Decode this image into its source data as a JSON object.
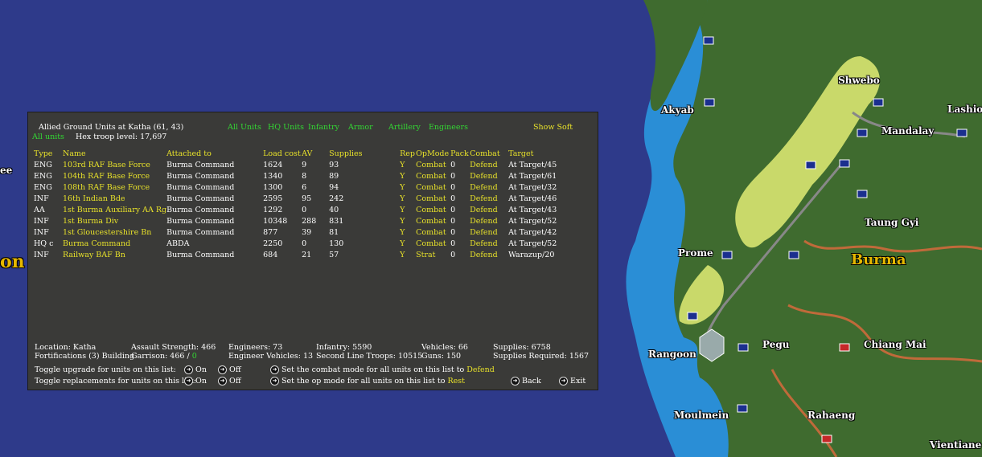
{
  "map": {
    "labels": [
      "ee",
      "on",
      "Akyab",
      "Shwebo",
      "Lashio",
      "Mandalay",
      "Taung Gyi",
      "Burma",
      "Prome",
      "Rangoon",
      "Pegu",
      "Chiang Mai",
      "Moulmein",
      "Rahaeng",
      "Vientiane"
    ],
    "land_color": "#3f6b2f",
    "sea_color": "#2e3a8a",
    "coast_color": "#2a8ed6",
    "highlight_color": "#c9d96a"
  },
  "panel": {
    "title": "Allied Ground Units at Katha  (61, 43)",
    "filter_all_units": "All units",
    "hex_troop_level": "Hex troop level: 17,697",
    "filters": [
      "All Units",
      "HQ Units",
      "Infantry",
      "Armor",
      "Artillery",
      "Engineers"
    ],
    "show_soft": "Show Soft",
    "columns": [
      "Type",
      "Name",
      "Attached to",
      "Load cost",
      "AV",
      "Supplies",
      "Rep",
      "OpMode",
      "Pack",
      "Combat",
      "Target"
    ],
    "rows": [
      [
        "ENG",
        "103rd RAF Base Force",
        "Burma Command",
        "1624",
        "9",
        "93",
        "Y",
        "Combat",
        "0",
        "Defend",
        "At Target/45"
      ],
      [
        "ENG",
        "104th RAF Base Force",
        "Burma Command",
        "1340",
        "8",
        "89",
        "Y",
        "Combat",
        "0",
        "Defend",
        "At Target/61"
      ],
      [
        "ENG",
        "108th RAF Base Force",
        "Burma Command",
        "1300",
        "6",
        "94",
        "Y",
        "Combat",
        "0",
        "Defend",
        "At Target/32"
      ],
      [
        "INF",
        "16th Indian Bde",
        "Burma Command",
        "2595",
        "95",
        "242",
        "Y",
        "Combat",
        "0",
        "Defend",
        "At Target/46"
      ],
      [
        "AA",
        "1st Burma Auxiliary AA Rg",
        "Burma Command",
        "1292",
        "0",
        "40",
        "Y",
        "Combat",
        "0",
        "Defend",
        "At Target/43"
      ],
      [
        "INF",
        "1st Burma Div",
        "Burma Command",
        "10348",
        "288",
        "831",
        "Y",
        "Combat",
        "0",
        "Defend",
        "At Target/52"
      ],
      [
        "INF",
        "1st Gloucestershire Bn",
        "Burma Command",
        "877",
        "39",
        "81",
        "Y",
        "Combat",
        "0",
        "Defend",
        "At Target/42"
      ],
      [
        "HQ c",
        "Burma Command",
        "ABDA",
        "2250",
        "0",
        "130",
        "Y",
        "Combat",
        "0",
        "Defend",
        "At Target/52"
      ],
      [
        "INF",
        "Railway BAF Bn",
        "Burma Command",
        "684",
        "21",
        "57",
        "Y",
        "Strat",
        "0",
        "Defend",
        "Warazup/20"
      ]
    ],
    "summary": {
      "location": "Location: Katha",
      "fortifications": "Fortifications (3) Building",
      "assault_strength": "Assault Strength: 466",
      "garrison_label": "Garrison: 466 /",
      "garrison_value": "0",
      "engineers": "Engineers: 73",
      "engineer_vehicles": "Engineer Vehicles: 13",
      "infantry": "Infantry: 5590",
      "second_line": "Second Line Troops: 10515",
      "vehicles": "Vehicles: 66",
      "guns": "Guns: 150",
      "supplies": "Supplies: 6758",
      "supplies_required": "Supplies Required: 1567"
    },
    "controls": {
      "toggle_upgrade": "Toggle upgrade for units on this list:",
      "toggle_replacements": "Toggle replacements for units on this list:",
      "on": "On",
      "off": "Off",
      "set_combat": "Set the combat mode for all units on this list to",
      "combat_value": "Defend",
      "set_op": "Set the op mode for all units on this list to",
      "op_value": "Rest",
      "back": "Back",
      "exit": "Exit"
    }
  }
}
